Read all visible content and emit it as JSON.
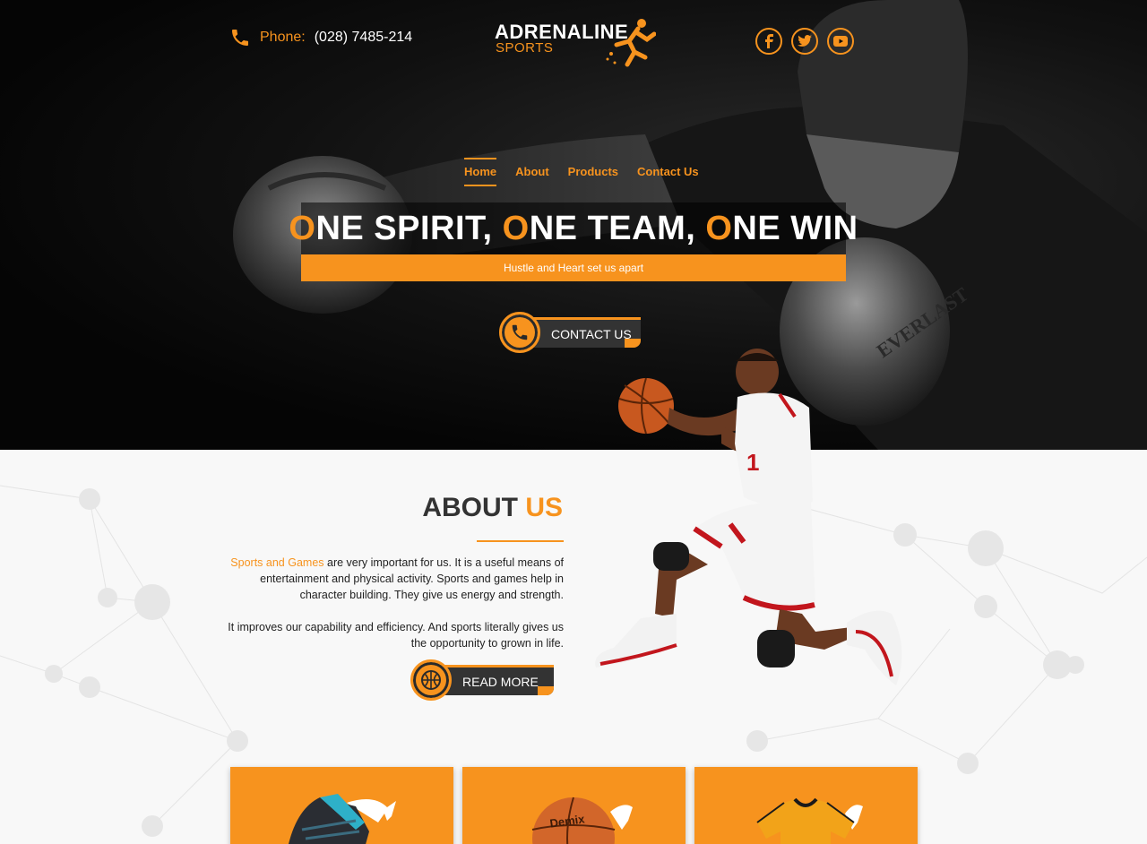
{
  "header": {
    "phone_label": "Phone:",
    "phone_number": "(028) 7485-214",
    "logo_top": "ADRENALINE",
    "logo_bottom": "SPORTS",
    "socials": [
      "facebook-icon",
      "twitter-icon",
      "youtube-icon"
    ]
  },
  "nav": {
    "items": [
      {
        "label": "Home",
        "active": true
      },
      {
        "label": "About",
        "active": false
      },
      {
        "label": "Products",
        "active": false
      },
      {
        "label": "Contact Us",
        "active": false
      }
    ]
  },
  "hero": {
    "headline_parts": [
      "O",
      "NE SPIRIT, ",
      "O",
      "NE TEAM, ",
      "O",
      "NE WIN"
    ],
    "subline": "Hustle and Heart set us apart",
    "cta_label": "CONTACT US"
  },
  "about": {
    "title_main": "ABOUT ",
    "title_accent": "US",
    "p1_highlight": "Sports and Games",
    "p1_rest": " are very important for us. It is a useful means of entertainment and physical activity. Sports and games help in character building. They give us energy and strength.",
    "p2": "It improves our capability and efficiency. And sports literally gives us the opportunity to grown in life.",
    "read_more": "READ MORE"
  },
  "products": [
    {
      "icon": "sneaker-icon"
    },
    {
      "icon": "basketball-icon"
    },
    {
      "icon": "jersey-icon"
    }
  ],
  "colors": {
    "accent": "#f7931e",
    "dark": "#333333"
  }
}
